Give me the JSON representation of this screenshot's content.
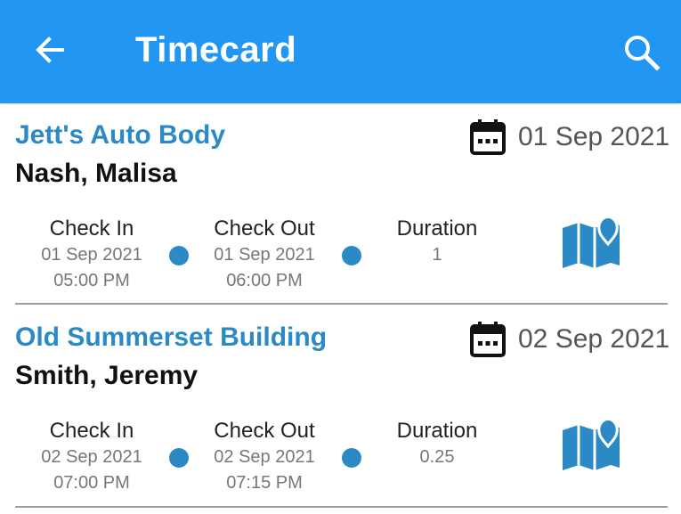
{
  "header": {
    "title": "Timecard",
    "background_color": "#2196f3",
    "back_icon": "arrow-left-icon",
    "search_icon": "search-icon"
  },
  "accent_color": "#2b8ac6",
  "entries": [
    {
      "company": "Jett's Auto Body",
      "person": "Nash, Malisa",
      "date": "01 Sep 2021",
      "check_in": {
        "label": "Check In",
        "date": "01 Sep 2021",
        "time": "05:00 PM"
      },
      "check_out": {
        "label": "Check Out",
        "date": "01 Sep 2021",
        "time": "06:00 PM"
      },
      "duration": {
        "label": "Duration",
        "value": "1"
      }
    },
    {
      "company": "Old Summerset Building",
      "person": "Smith, Jeremy",
      "date": "02 Sep 2021",
      "check_in": {
        "label": "Check In",
        "date": "02 Sep 2021",
        "time": "07:00 PM"
      },
      "check_out": {
        "label": "Check Out",
        "date": "02 Sep 2021",
        "time": "07:15 PM"
      },
      "duration": {
        "label": "Duration",
        "value": "0.25"
      }
    }
  ]
}
